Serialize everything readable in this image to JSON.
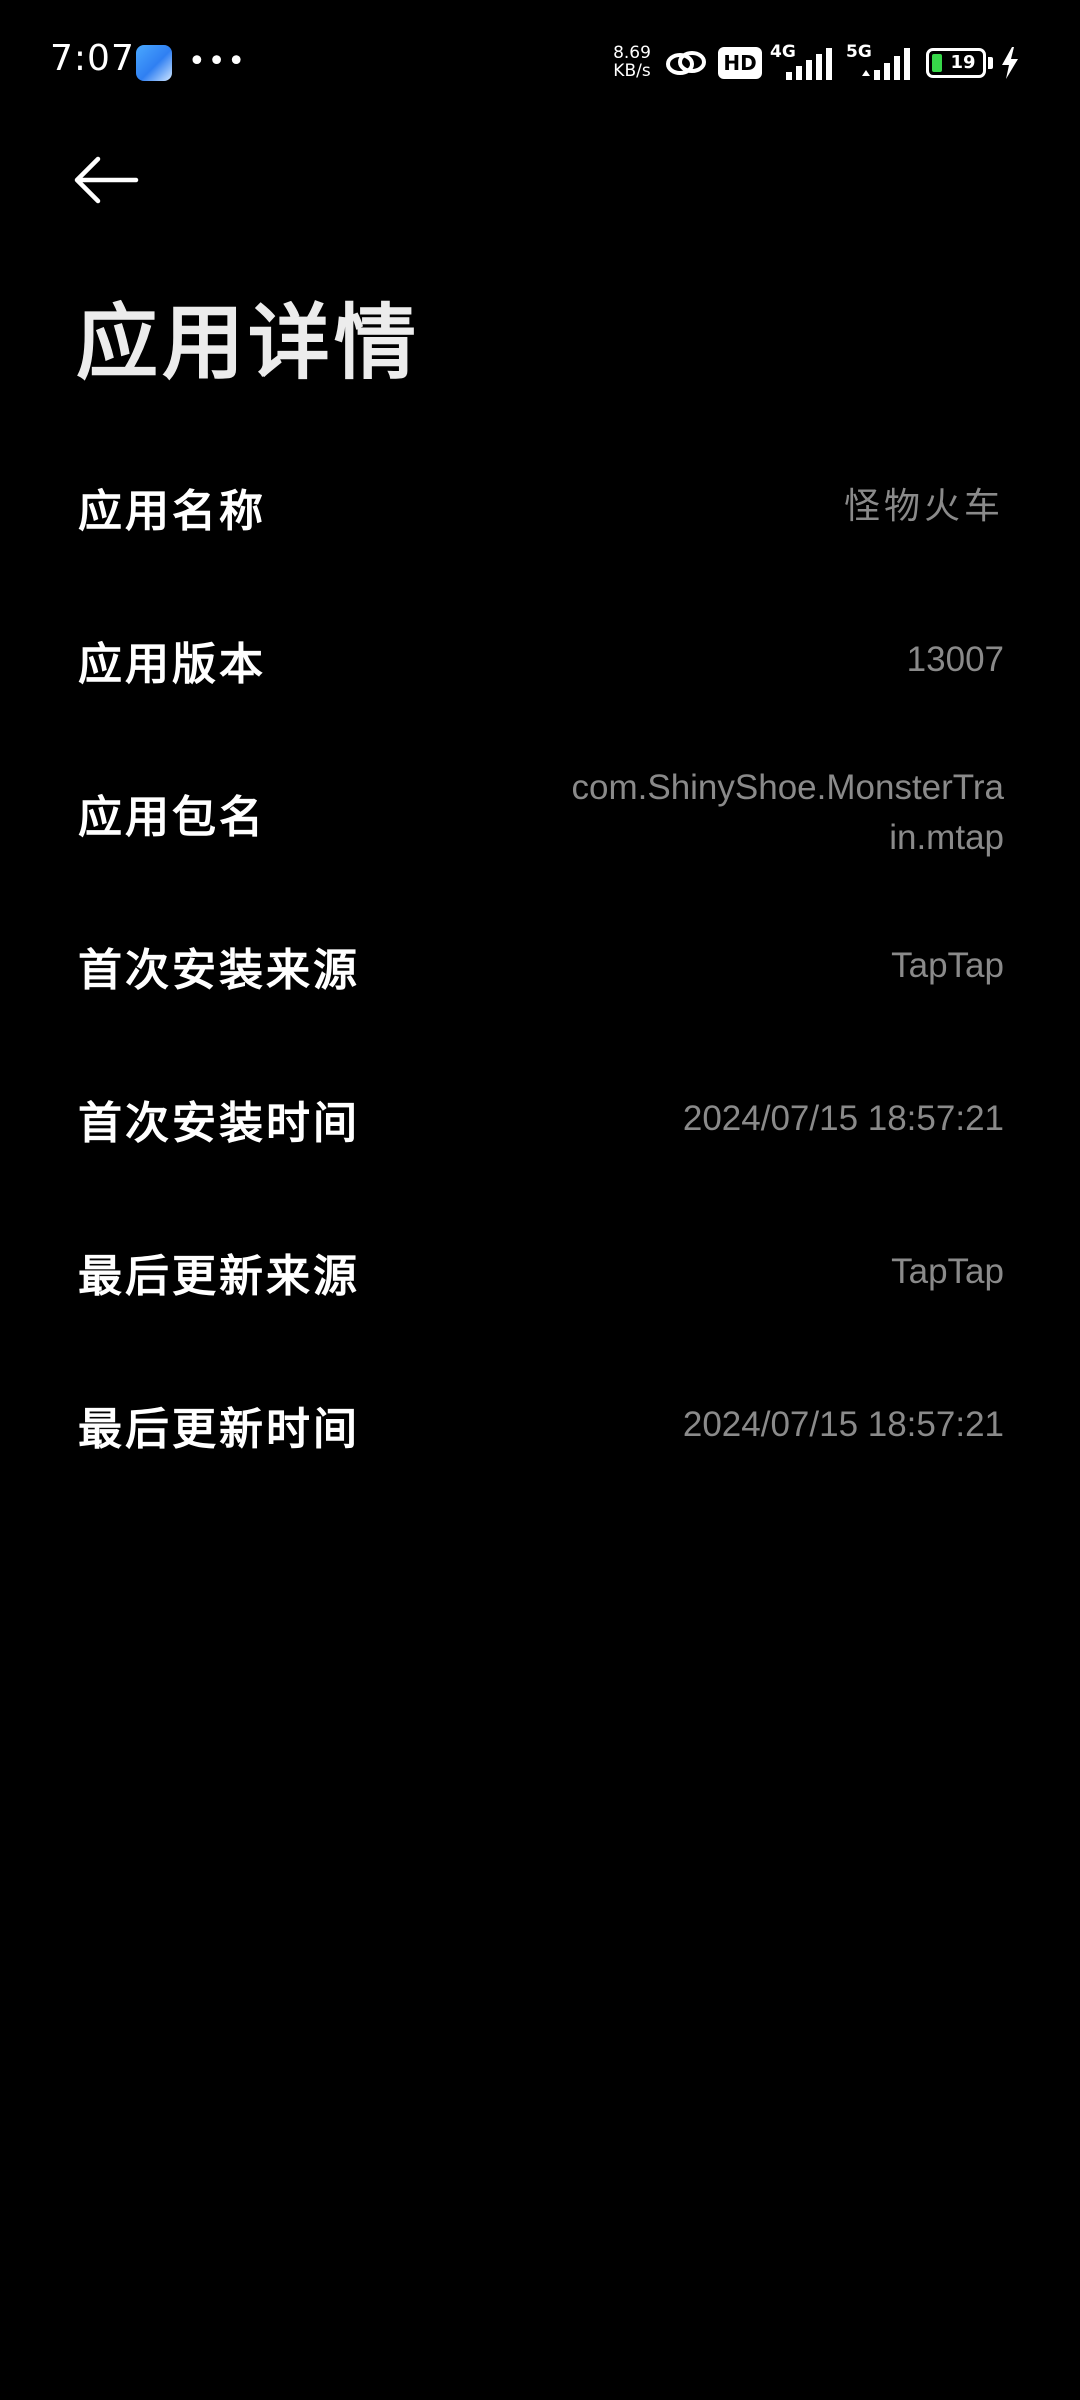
{
  "status_bar": {
    "time": "7:07",
    "net_speed_value": "8.69",
    "net_speed_unit": "KB/s",
    "hd_label": "HD",
    "network_1": "4G",
    "network_2": "5G",
    "battery_level": "19",
    "battery_color": "#37d84a",
    "icons": [
      "app-notification-icon",
      "more-dots-icon",
      "link-icon",
      "hd-icon",
      "signal-icon",
      "signal-icon",
      "battery-icon",
      "charging-icon"
    ]
  },
  "header": {
    "back_icon": "arrow-left-icon",
    "title": "应用详情"
  },
  "details": [
    {
      "label": "应用名称",
      "value": "怪物火车"
    },
    {
      "label": "应用版本",
      "value": "13007"
    },
    {
      "label": "应用包名",
      "value": "com.ShinyShoe.MonsterTrain.mtap"
    },
    {
      "label": "首次安装来源",
      "value": "TapTap"
    },
    {
      "label": "首次安装时间",
      "value": "2024/07/15 18:57:21"
    },
    {
      "label": "最后更新来源",
      "value": "TapTap"
    },
    {
      "label": "最后更新时间",
      "value": "2024/07/15 18:57:21"
    }
  ],
  "colors": {
    "background": "#000000",
    "label": "#ffffff",
    "value": "#8a8a8a"
  }
}
